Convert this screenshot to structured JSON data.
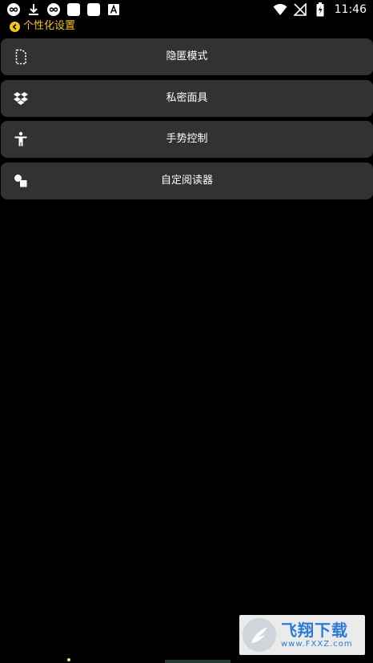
{
  "status_bar": {
    "time": "11:46",
    "left_icons": [
      "infinity-icon",
      "download-icon",
      "infinity-icon",
      "app-square-icon",
      "app-square-icon",
      "font-a-icon"
    ],
    "right_icons": [
      "wifi-icon",
      "no-sim-icon",
      "battery-charging-icon"
    ]
  },
  "header": {
    "title": "个性化设置",
    "accent_color": "#f5c518"
  },
  "menu": {
    "items": [
      {
        "label": "隐匿模式",
        "icon": "document-icon"
      },
      {
        "label": "私密面具",
        "icon": "dropbox-icon"
      },
      {
        "label": "手势控制",
        "icon": "accessibility-icon"
      },
      {
        "label": "自定阅读器",
        "icon": "shapes-icon"
      }
    ]
  },
  "watermark": {
    "title": "飞翔下载",
    "url": "www.FXXZ.com"
  },
  "colors": {
    "background": "#000000",
    "item_background": "#323232",
    "text": "#ffffff"
  }
}
